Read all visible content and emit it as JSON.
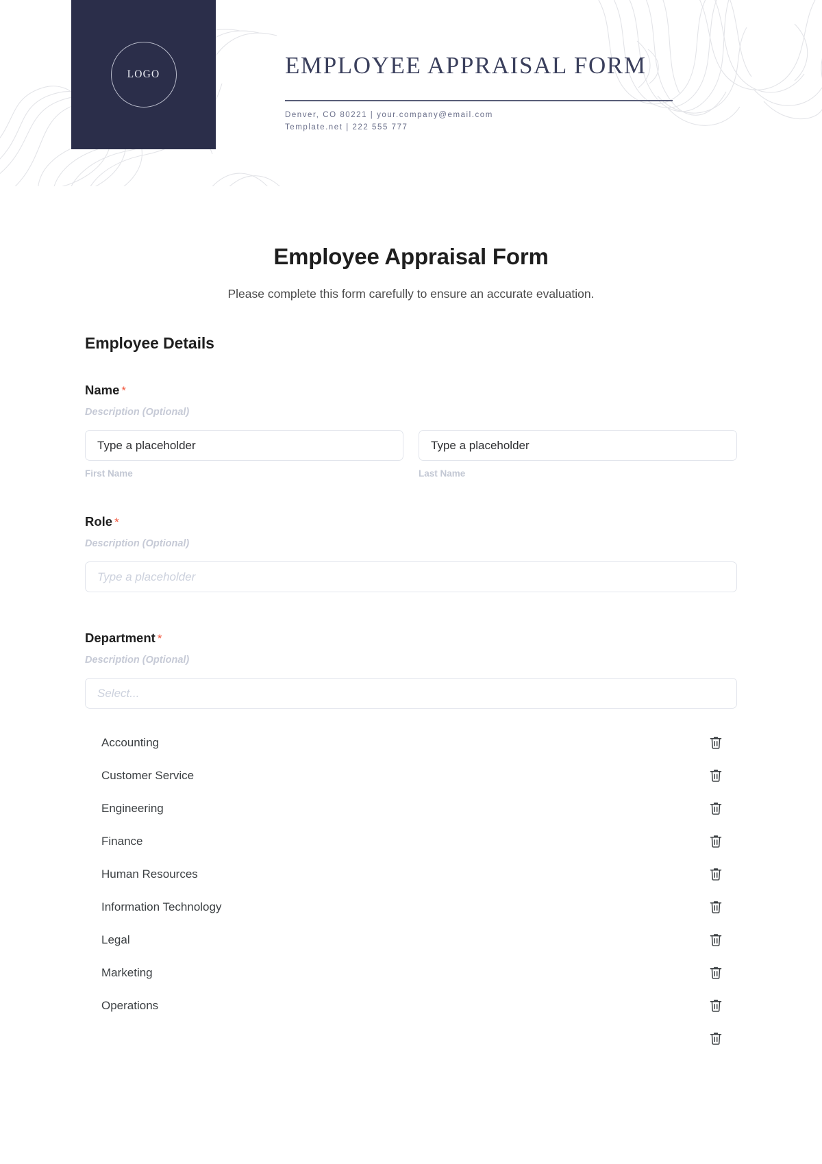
{
  "header": {
    "logo_text": "LOGO",
    "title": "EMPLOYEE APPRAISAL FORM",
    "contact_line1": "Denver, CO 80221 | your.company@email.com",
    "contact_line2": "Template.net | 222 555 777",
    "brand_color": "#2b2e4a",
    "rule_color": "#585d78"
  },
  "form": {
    "title": "Employee Appraisal Form",
    "subtitle": "Please complete this form carefully to ensure an accurate evaluation.",
    "section_heading": "Employee Details",
    "required_marker": "*",
    "description_placeholder": "Description (Optional)",
    "required_color": "#f2583e"
  },
  "fields": {
    "name": {
      "label": "Name",
      "description": "Description (Optional)",
      "first": {
        "value": "Type a placeholder",
        "sub_label": "First Name"
      },
      "last": {
        "value": "Type a placeholder",
        "sub_label": "Last Name"
      }
    },
    "role": {
      "label": "Role",
      "description": "Description (Optional)",
      "placeholder": "Type a placeholder"
    },
    "department": {
      "label": "Department",
      "description": "Description (Optional)",
      "select_placeholder": "Select...",
      "options": [
        "Accounting",
        "Customer Service",
        "Engineering",
        "Finance",
        "Human Resources",
        "Information Technology",
        "Legal",
        "Marketing",
        "Operations"
      ],
      "delete_icon": "trash-icon"
    }
  }
}
